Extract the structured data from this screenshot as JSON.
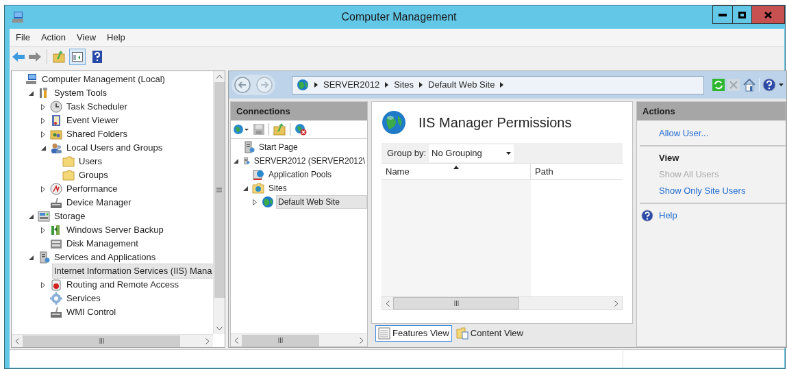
{
  "window": {
    "title": "Computer Management"
  },
  "menu": [
    "File",
    "Action",
    "View",
    "Help"
  ],
  "tree": [
    {
      "label": "Computer Management (Local)",
      "kind": "computer",
      "selected": false,
      "children": [
        {
          "label": "System Tools",
          "kind": "tools",
          "expanded": true,
          "selected": false,
          "children": [
            {
              "label": "Task Scheduler",
              "kind": "clock",
              "expanded": false,
              "selected": false
            },
            {
              "label": "Event Viewer",
              "kind": "log",
              "expanded": false,
              "selected": false
            },
            {
              "label": "Shared Folders",
              "kind": "shared",
              "expanded": false,
              "selected": false
            },
            {
              "label": "Local Users and Groups",
              "kind": "users",
              "expanded": true,
              "selected": false,
              "children": [
                {
                  "label": "Users",
                  "kind": "folder",
                  "selected": false
                },
                {
                  "label": "Groups",
                  "kind": "folder",
                  "selected": false
                }
              ]
            },
            {
              "label": "Performance",
              "kind": "gauge",
              "expanded": false,
              "selected": false
            },
            {
              "label": "Device Manager",
              "kind": "device",
              "selected": false
            }
          ]
        },
        {
          "label": "Storage",
          "kind": "storage",
          "expanded": true,
          "selected": false,
          "children": [
            {
              "label": "Windows Server Backup",
              "kind": "backup",
              "expanded": false,
              "selected": false
            },
            {
              "label": "Disk Management",
              "kind": "disk",
              "selected": false
            }
          ]
        },
        {
          "label": "Services and Applications",
          "kind": "server",
          "expanded": true,
          "selected": false,
          "children": [
            {
              "label": "Internet Information Services (IIS) Mana",
              "kind": "iis",
              "selected": true
            },
            {
              "label": "Routing and Remote Access",
              "kind": "routing",
              "expanded": false,
              "selected": false
            },
            {
              "label": "Services",
              "kind": "gear",
              "selected": false
            },
            {
              "label": "WMI Control",
              "kind": "device",
              "selected": false
            }
          ]
        }
      ]
    }
  ],
  "iis": {
    "breadcrumbs": [
      "SERVER2012",
      "Sites",
      "Default Web Site"
    ],
    "connections": {
      "title": "Connections",
      "tree": [
        {
          "label": "Start Page",
          "kind": "server",
          "selected": false
        },
        {
          "label": "SERVER2012 (SERVER2012\\",
          "kind": "server",
          "expanded": true,
          "selected": false,
          "children": [
            {
              "label": "Application Pools",
              "kind": "pools",
              "selected": false
            },
            {
              "label": "Sites",
              "kind": "sitefolder",
              "expanded": true,
              "selected": false,
              "children": [
                {
                  "label": "Default Web Site",
                  "kind": "globe",
                  "expanded": false,
                  "selected": true
                }
              ]
            }
          ]
        }
      ]
    },
    "feature": {
      "title": "IIS Manager Permissions",
      "group_by_label": "Group by:",
      "group_by_value": "No Grouping",
      "columns": [
        "Name",
        "Path"
      ]
    },
    "view_tabs": [
      {
        "label": "Features View",
        "selected": true
      },
      {
        "label": "Content View",
        "selected": false
      }
    ],
    "actions": {
      "title": "Actions",
      "items": [
        {
          "kind": "link",
          "label": "Allow User...",
          "disabled": false
        },
        {
          "kind": "separator"
        },
        {
          "kind": "heading",
          "label": "View"
        },
        {
          "kind": "link",
          "label": "Show All Users",
          "disabled": true
        },
        {
          "kind": "link",
          "label": "Show Only Site Users",
          "disabled": false
        },
        {
          "kind": "separator"
        },
        {
          "kind": "help",
          "label": "Help",
          "disabled": false
        }
      ]
    }
  }
}
